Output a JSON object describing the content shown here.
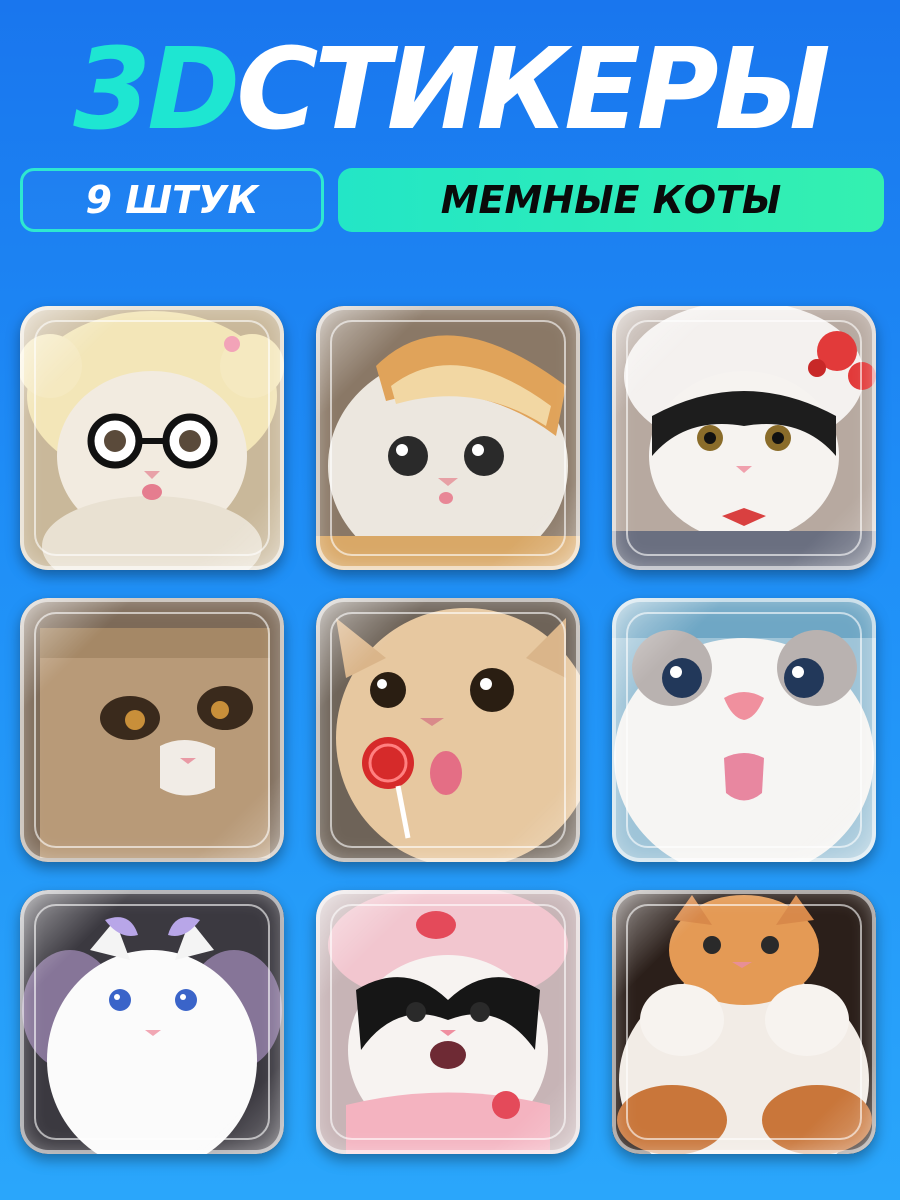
{
  "header": {
    "title_prefix": "3D",
    "title_word": "СТИКЕРЫ",
    "count_label": "9 ШТУК",
    "theme_label": "МЕМНЫЕ КОТЫ"
  },
  "colors": {
    "accent": "#1ee6d2",
    "background_top": "#1976ee",
    "background_bottom": "#2aa6fb",
    "theme_pill": "#23e6c6"
  },
  "stickers": [
    {
      "image": "cat-in-yellow-hat-with-glasses-image"
    },
    {
      "image": "cat-with-bread-slice-image"
    },
    {
      "image": "black-white-cat-in-hello-kitty-hat-image"
    },
    {
      "image": "cat-in-paper-bag-image"
    },
    {
      "image": "cat-with-lollipop-image"
    },
    {
      "image": "white-cat-tongue-out-image"
    },
    {
      "image": "white-fluffy-cat-with-bow-image"
    },
    {
      "image": "black-white-cat-in-pink-hat-image"
    },
    {
      "image": "ginger-cat-paws-up-image"
    }
  ]
}
